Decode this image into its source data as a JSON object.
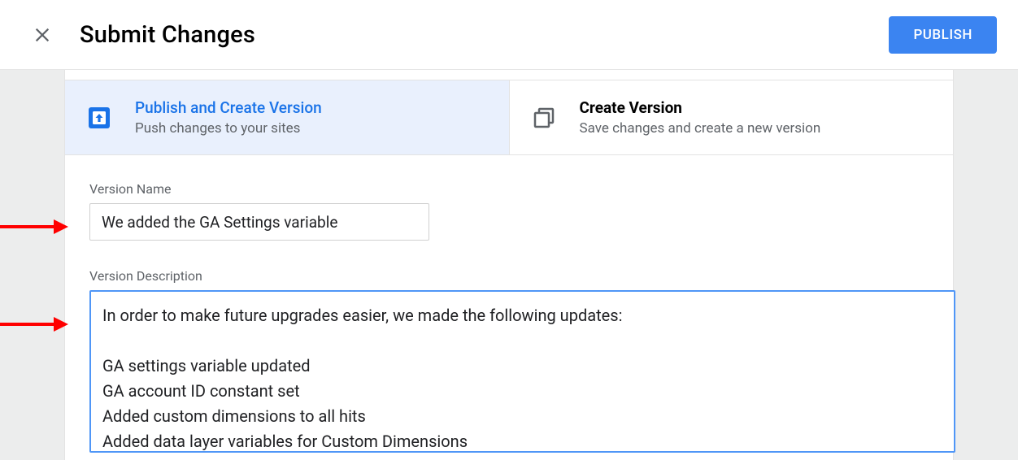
{
  "header": {
    "title": "Submit Changes",
    "publish_button": "PUBLISH"
  },
  "tabs": {
    "publish": {
      "title": "Publish and Create Version",
      "subtitle": "Push changes to your sites"
    },
    "create": {
      "title": "Create Version",
      "subtitle": "Save changes and create a new version"
    }
  },
  "form": {
    "version_name_label": "Version Name",
    "version_name_value": "We added the GA Settings variable",
    "version_description_label": "Version Description",
    "version_description_value": "In order to make future upgrades easier, we made the following updates:\n\nGA settings variable updated\nGA account ID constant set\nAdded custom dimensions to all hits\nAdded data layer variables for Custom Dimensions"
  }
}
